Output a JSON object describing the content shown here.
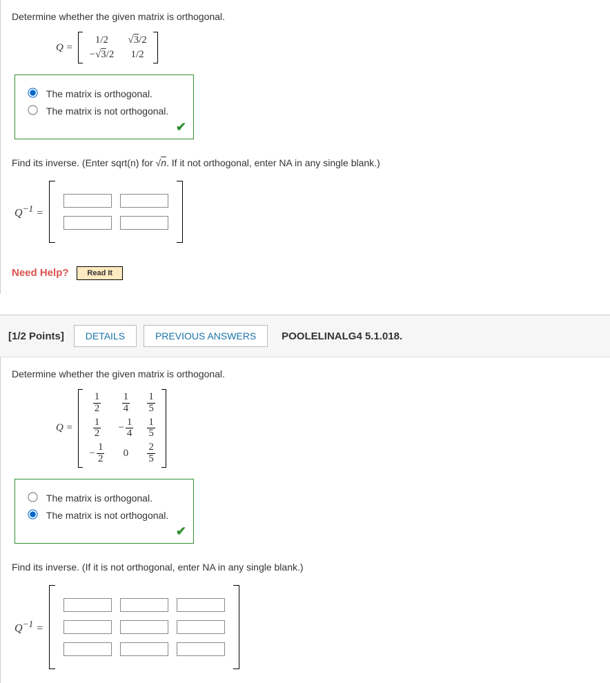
{
  "q1": {
    "prompt": "Determine whether the given matrix is orthogonal.",
    "matrix_label": "Q =",
    "matrix": [
      [
        "1/2",
        "√3/2"
      ],
      [
        "−√3/2",
        "1/2"
      ]
    ],
    "choices": {
      "a": "The matrix is orthogonal.",
      "b": "The matrix is not orthogonal."
    },
    "selected": "a",
    "correct": true,
    "sub_prompt": "Find its inverse. (Enter sqrt(n) for √n. If it not orthogonal, enter NA in any single blank.)",
    "inverse_label": "Q⁻¹ =",
    "inverse_rows": 2,
    "inverse_cols": 2,
    "need_help_label": "Need Help?",
    "read_it": "Read It"
  },
  "header": {
    "points": "[1/2 Points]",
    "details": "DETAILS",
    "previous": "PREVIOUS ANSWERS",
    "source": "POOLELINALG4 5.1.018."
  },
  "q2": {
    "prompt": "Determine whether the given matrix is orthogonal.",
    "matrix_label": "Q =",
    "matrix": [
      [
        "1/2",
        "1/4",
        "1/5"
      ],
      [
        "1/2",
        "−1/4",
        "1/5"
      ],
      [
        "−1/2",
        "0",
        "2/5"
      ]
    ],
    "choices": {
      "a": "The matrix is orthogonal.",
      "b": "The matrix is not orthogonal."
    },
    "selected": "b",
    "correct": true,
    "sub_prompt": "Find its inverse. (If it is not orthogonal, enter NA in any single blank.)",
    "inverse_label": "Q⁻¹ =",
    "inverse_rows": 3,
    "inverse_cols": 3
  },
  "chart_data": {
    "type": "table",
    "q1_matrix": [
      [
        "1/2",
        "sqrt(3)/2"
      ],
      [
        "-sqrt(3)/2",
        "1/2"
      ]
    ],
    "q2_matrix": [
      [
        "1/2",
        "1/4",
        "1/5"
      ],
      [
        "1/2",
        "-1/4",
        "1/5"
      ],
      [
        "-1/2",
        "0",
        "2/5"
      ]
    ]
  }
}
